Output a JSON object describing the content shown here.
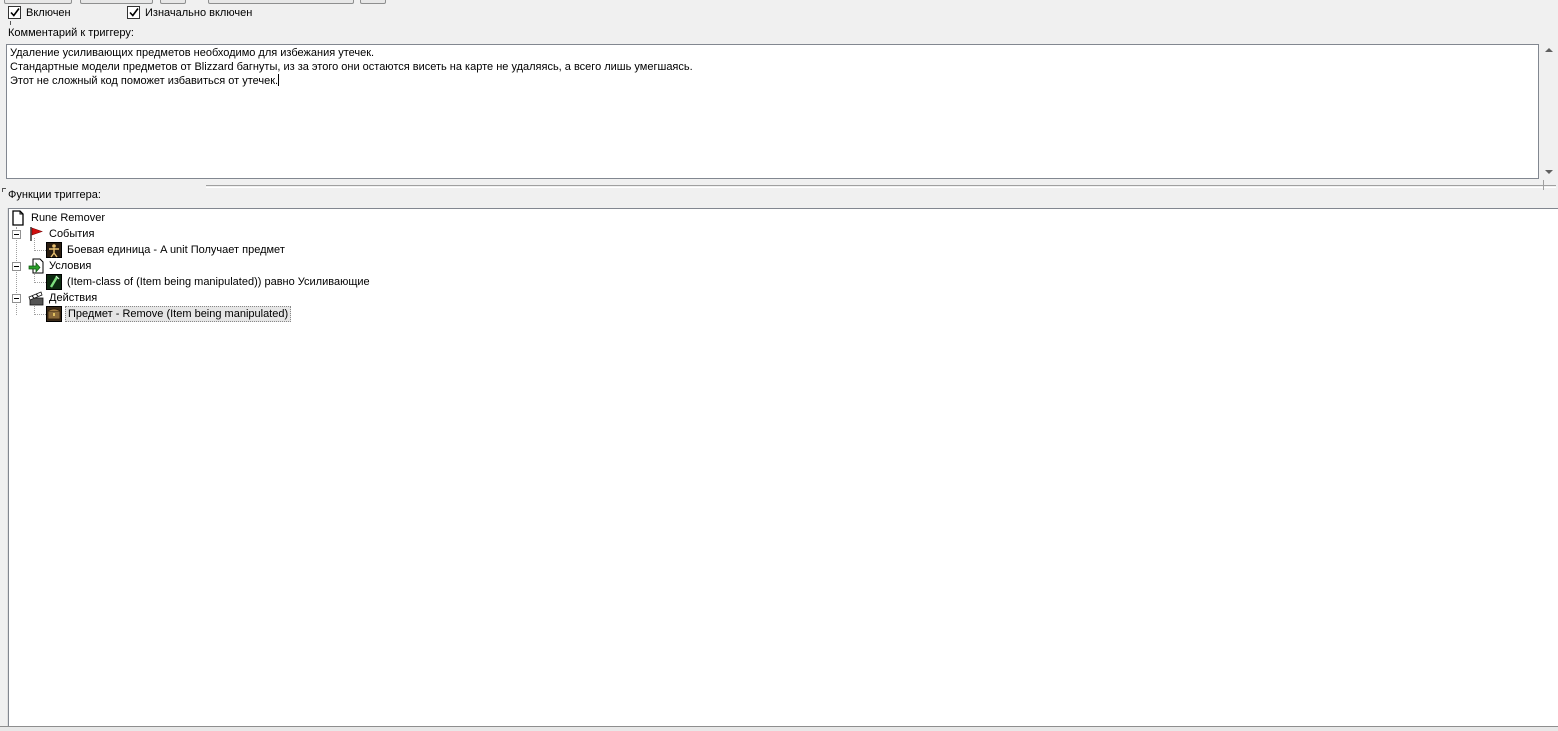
{
  "checkboxes": {
    "enabled": {
      "label": "Включен",
      "checked": true
    },
    "initially_on": {
      "label": "Изначально включен",
      "checked": true
    }
  },
  "comment": {
    "label": "Комментарий к триггеру:",
    "lines": [
      "Удаление усиливающих предметов необходимо для избежания утечек.",
      "Стандартные модели предметов от Blizzard багнуты, из за этого они остаются висеть на карте не удаляясь, а всего лишь умегшаясь.",
      "Этот не сложный код поможет избавиться от утечек."
    ]
  },
  "functions": {
    "label": "Функции триггера:",
    "root": {
      "label": "Rune Remover",
      "icon": "document-icon"
    },
    "events": {
      "label": "События",
      "icon": "red-flag-icon"
    },
    "event_item": {
      "label": "Боевая единица - A unit Получает предмет",
      "icon": "unit-icon"
    },
    "conditions": {
      "label": "Условия",
      "icon": "condition-arrow-icon"
    },
    "condition_item": {
      "label": "(Item-class of (Item being manipulated)) равно Усиливающие",
      "icon": "item-class-icon"
    },
    "actions": {
      "label": "Действия",
      "icon": "clapperboard-icon"
    },
    "action_item": {
      "label": "Предмет - Remove (Item being manipulated)",
      "icon": "chest-icon",
      "selected": true
    }
  },
  "colors": {
    "window_bg": "#f0f0f0",
    "border": "#828790",
    "selection": "#e6e6e6",
    "flag": "#d01010"
  }
}
